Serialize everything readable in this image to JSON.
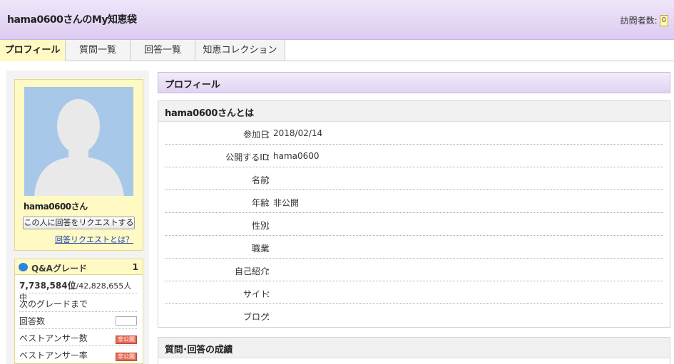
{
  "header": {
    "title": "hama0600さんのMy知恵袋",
    "visitors_label": "訪問者数:",
    "visitors_count": "0"
  },
  "tabs": [
    {
      "label": "プロフィール"
    },
    {
      "label": "質問一覧"
    },
    {
      "label": "回答一覧"
    },
    {
      "label": "知恵コレクション"
    }
  ],
  "sidebar": {
    "username": "hama0600さん",
    "request_button": "この人に回答をリクエストする",
    "request_link": "回答リクエストとは？",
    "grade": {
      "title": "Q&Aグレード",
      "value": "1",
      "rank": "7,738,584位",
      "rank_total": "/42,828,655人中",
      "next_grade": "次のグレードまで",
      "answers_label": "回答数",
      "best_count_label": "ベストアンサー数",
      "best_rate_label": "ベストアンサー率",
      "locked_label": "非公開"
    }
  },
  "main": {
    "section_title": "プロフィール",
    "about": {
      "title": "hama0600さんとは",
      "sep": "：",
      "rows": [
        {
          "label": "参加日",
          "value": "2018/02/14"
        },
        {
          "label": "公開するID",
          "value": "hama0600"
        },
        {
          "label": "名前",
          "value": ""
        },
        {
          "label": "年齢",
          "value": "非公開"
        },
        {
          "label": "性別",
          "value": ""
        },
        {
          "label": "職業",
          "value": ""
        },
        {
          "label": "自己紹介",
          "value": ""
        },
        {
          "label": "サイト",
          "value": ""
        },
        {
          "label": "ブログ",
          "value": ""
        }
      ]
    },
    "results_title": "質問･回答の成績"
  },
  "colors": {
    "header_gradient": "#dccbf0",
    "active_tab": "#fff9c4",
    "avatar_bg": "#a7c8e8",
    "link": "#1a3fb0"
  }
}
